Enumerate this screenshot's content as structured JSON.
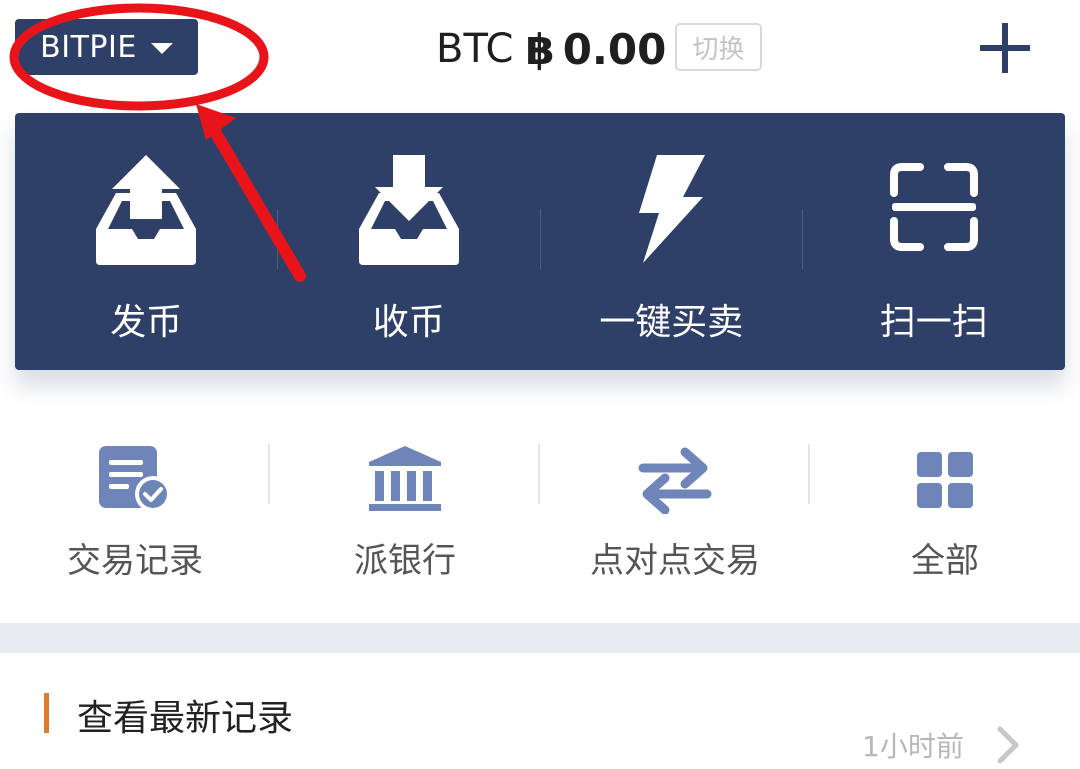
{
  "header": {
    "wallet_label": "BITPIE",
    "currency": "BTC",
    "currency_symbol": "฿",
    "balance": "0.00",
    "switch_label": "切换"
  },
  "actions": [
    {
      "label": "发币",
      "icon": "send-icon"
    },
    {
      "label": "收币",
      "icon": "receive-icon"
    },
    {
      "label": "一键买卖",
      "icon": "lightning-icon"
    },
    {
      "label": "扫一扫",
      "icon": "scan-icon"
    }
  ],
  "shortcuts": [
    {
      "label": "交易记录",
      "icon": "transaction-record-icon"
    },
    {
      "label": "派银行",
      "icon": "bank-icon"
    },
    {
      "label": "点对点交易",
      "icon": "p2p-exchange-icon"
    },
    {
      "label": "全部",
      "icon": "grid-icon"
    }
  ],
  "records": {
    "title": "查看最新记录",
    "time": "1小时前"
  },
  "colors": {
    "primary": "#2f4068",
    "accent": "#e07a2a",
    "icon_blue": "#6f84b8",
    "annotation_red": "#e8141a"
  }
}
